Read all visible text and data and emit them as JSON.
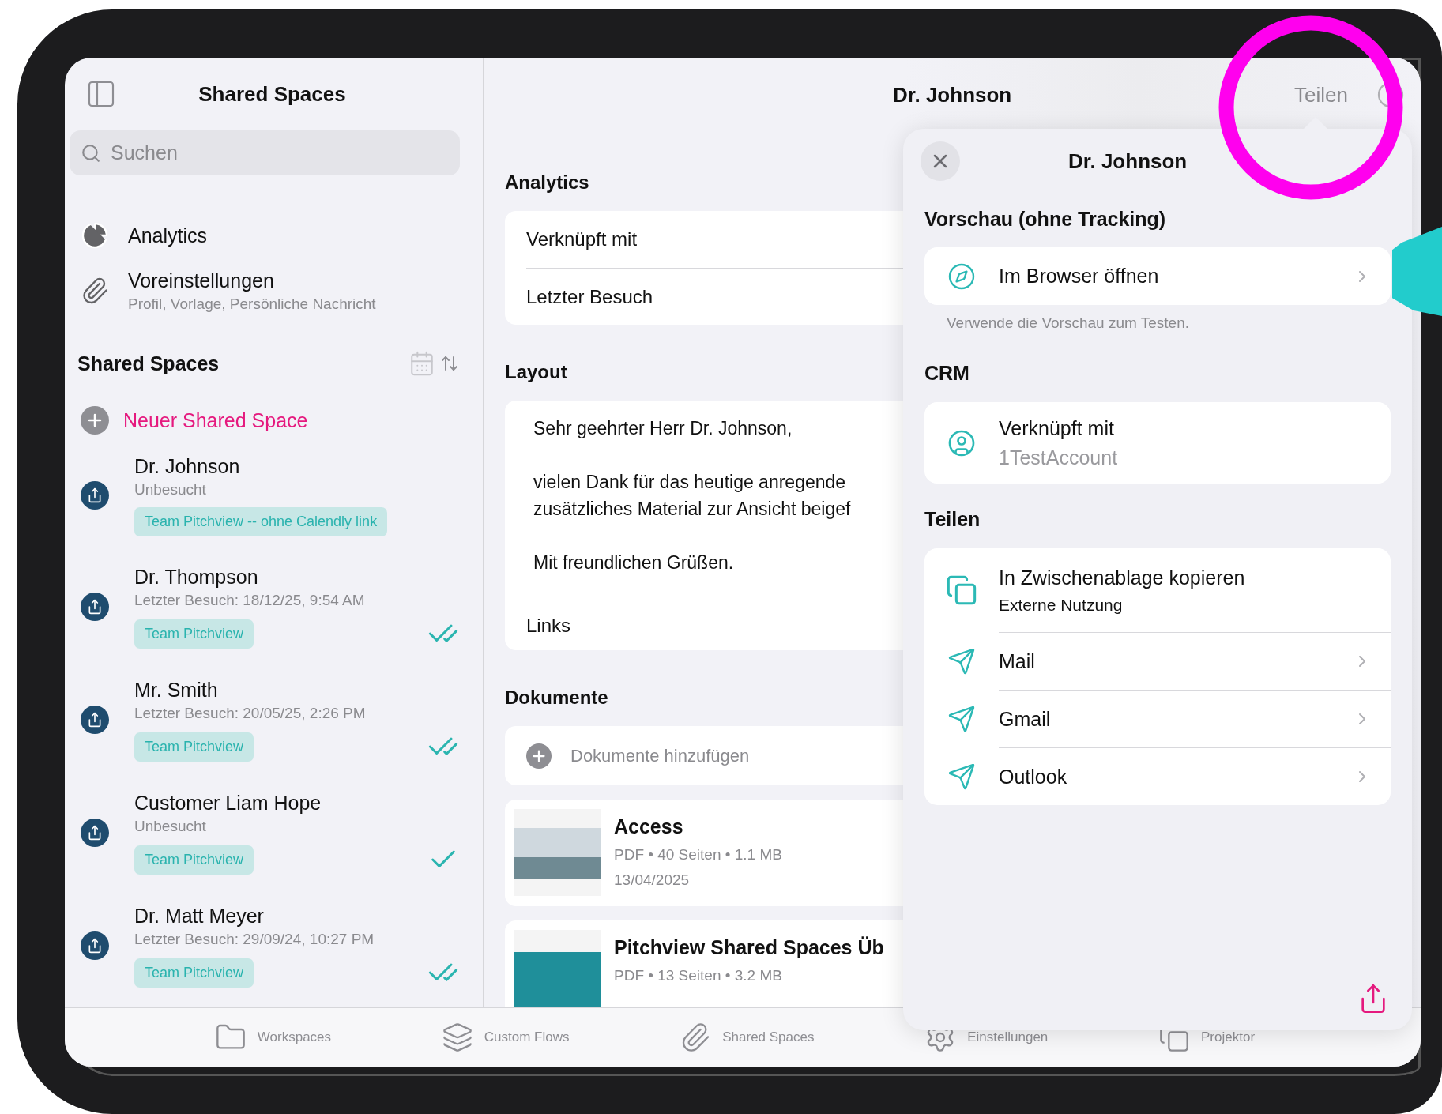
{
  "sidebar": {
    "title": "Shared Spaces",
    "search": {
      "placeholder": "Suchen"
    },
    "nav": [
      {
        "kind": "analytics",
        "label": "Analytics"
      },
      {
        "kind": "presets",
        "label": "Voreinstellungen",
        "subtitle": "Profil, Vorlage, Persönliche Nachricht"
      }
    ],
    "section_title": "Shared Spaces",
    "new_button": "Neuer Shared Space",
    "spaces": [
      {
        "name": "Dr. Johnson",
        "status": "Unbesucht",
        "tag": "Team Pitchview -- ohne Calendly link",
        "kind": "none"
      },
      {
        "name": "Dr. Thompson",
        "status": "Letzter Besuch: 18/12/25, 9:54 AM",
        "tag": "Team Pitchview",
        "kind": "double"
      },
      {
        "name": "Mr. Smith",
        "status": "Letzter Besuch: 20/05/25, 2:26 PM",
        "tag": "Team Pitchview",
        "kind": "double"
      },
      {
        "name": "Customer Liam Hope",
        "status": "Unbesucht",
        "tag": "Team Pitchview",
        "kind": "single"
      },
      {
        "name": "Dr. Matt Meyer",
        "status": "Letzter Besuch: 29/09/24, 10:27 PM",
        "tag": "Team Pitchview",
        "kind": "double"
      }
    ]
  },
  "detail": {
    "title": "Dr. Johnson",
    "share_button": "Teilen",
    "analytics": {
      "heading": "Analytics",
      "rows": [
        "Verknüpft mit",
        "Letzter Besuch"
      ]
    },
    "layout": {
      "heading": "Layout",
      "paragraphs": [
        "Sehr geehrter Herr Dr. Johnson,",
        "vielen Dank für das heutige anregende\nzusätzliches Material zur Ansicht beigef",
        "Mit freundlichen Grüßen."
      ],
      "links": "Links"
    },
    "documents": {
      "heading": "Dokumente",
      "add_label": "Dokumente hinzufügen",
      "files": [
        {
          "title": "Access",
          "meta": "PDF • 40 Seiten • 1.1 MB",
          "date": "13/04/2025"
        },
        {
          "title": "Pitchview Shared Spaces Üb",
          "meta": "PDF • 13 Seiten • 3.2 MB"
        }
      ]
    }
  },
  "popover": {
    "title": "Dr. Johnson",
    "preview": {
      "heading": "Vorschau (ohne Tracking)",
      "item": "Im Browser öffnen",
      "footnote": "Verwende die Vorschau zum Testen."
    },
    "crm": {
      "heading": "CRM",
      "label": "Verknüpft mit",
      "value": "1TestAccount"
    },
    "share": {
      "heading": "Teilen",
      "items": [
        {
          "kind": "clipboard",
          "label": "In Zwischenablage kopieren",
          "sublabel": "Externe Nutzung"
        },
        {
          "kind": "send",
          "label": "Mail"
        },
        {
          "kind": "send",
          "label": "Gmail"
        },
        {
          "kind": "send",
          "label": "Outlook"
        }
      ]
    }
  },
  "tab_bar": [
    {
      "kind": "folder",
      "label": "Workspaces"
    },
    {
      "kind": "layers",
      "label": "Custom Flows"
    },
    {
      "kind": "clip",
      "label": "Shared Spaces"
    },
    {
      "kind": "gear",
      "label": "Einstellungen"
    },
    {
      "kind": "projector",
      "label": "Projektor"
    }
  ]
}
